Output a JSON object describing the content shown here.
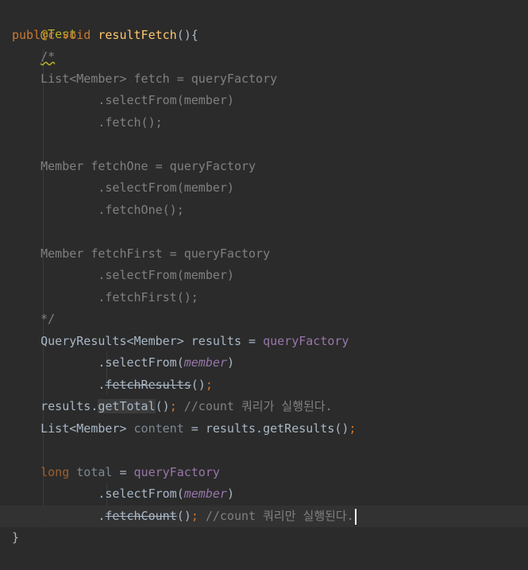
{
  "editor": {
    "language": "Java",
    "theme": "Darcula",
    "lines": [
      "@Test",
      "public void resultFetch(){",
      "    /*",
      "    List<Member> fetch = queryFactory",
      "            .selectFrom(member)",
      "            .fetch();",
      "",
      "    Member fetchOne = queryFactory",
      "            .selectFrom(member)",
      "            .fetchOne();",
      "",
      "    Member fetchFirst = queryFactory",
      "            .selectFrom(member)",
      "            .fetchFirst();",
      "    */",
      "    QueryResults<Member> results = queryFactory",
      "            .selectFrom(member)",
      "            .fetchResults();",
      "    results.getTotal(); //count 쿼리가 실행된다.",
      "    List<Member> content = results.getResults();",
      "",
      "    long total = queryFactory",
      "            .selectFrom(member)",
      "            .fetchCount(); //count 쿼리만 실행된다.",
      "}"
    ],
    "tokens": {
      "annotation": "@Test",
      "kw_public": "public",
      "kw_void": "void",
      "method_name": "resultFetch",
      "method_parens": "(){",
      "comment_open": "/*",
      "comment_close": "*/",
      "c1": "List<Member> fetch = queryFactory",
      "c2": ".selectFrom(member)",
      "c3": ".fetch();",
      "c4": "Member fetchOne = queryFactory",
      "c5": ".selectFrom(member)",
      "c6": ".fetchOne();",
      "c7": "Member fetchFirst = queryFactory",
      "c8": ".selectFrom(member)",
      "c9": ".fetchFirst();",
      "qr_type": "QueryResults<Member> results = ",
      "query_factory": "queryFactory",
      "select_from": ".selectFrom(",
      "member": "member",
      "close_paren": ")",
      "dot": ".",
      "fetch_results": "fetchResults",
      "call_end": "()",
      "semicolon": ";",
      "results_dot": "results.",
      "get_total": "getTotal",
      "comment_total": " //count 쿼리가 실행된다.",
      "list_member": "List<Member> ",
      "content_var": "content",
      "eq_results": " = results.getResults()",
      "kw_long": "long",
      "total_var": "total",
      "eq": " = ",
      "fetch_count": "fetchCount",
      "comment_count": " //count 쿼리만 실행된다.",
      "closing_brace": "}"
    }
  }
}
